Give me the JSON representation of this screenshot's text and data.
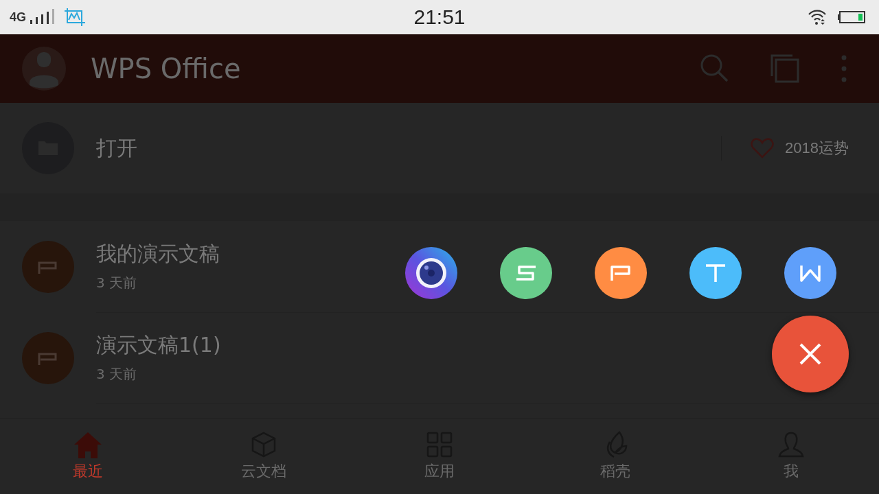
{
  "status_bar": {
    "network": "4G",
    "time": "21:51"
  },
  "app_bar": {
    "title": "WPS Office"
  },
  "open_row": {
    "label": "打开",
    "promo": "2018运势"
  },
  "documents": [
    {
      "kind": "presentation",
      "name": "我的演示文稿",
      "time": "3 天前"
    },
    {
      "kind": "presentation",
      "name": "演示文稿1(1)",
      "time": "3 天前"
    }
  ],
  "fab_menu": [
    {
      "kind": "camera"
    },
    {
      "kind": "spreadsheet"
    },
    {
      "kind": "presentation"
    },
    {
      "kind": "text"
    },
    {
      "kind": "writer"
    }
  ],
  "bottom_nav": [
    {
      "kind": "home",
      "label": "最近",
      "selected": true
    },
    {
      "kind": "cloud",
      "label": "云文档",
      "selected": false
    },
    {
      "kind": "apps",
      "label": "应用",
      "selected": false
    },
    {
      "kind": "shell",
      "label": "稻壳",
      "selected": false
    },
    {
      "kind": "me",
      "label": "我",
      "selected": false
    }
  ]
}
